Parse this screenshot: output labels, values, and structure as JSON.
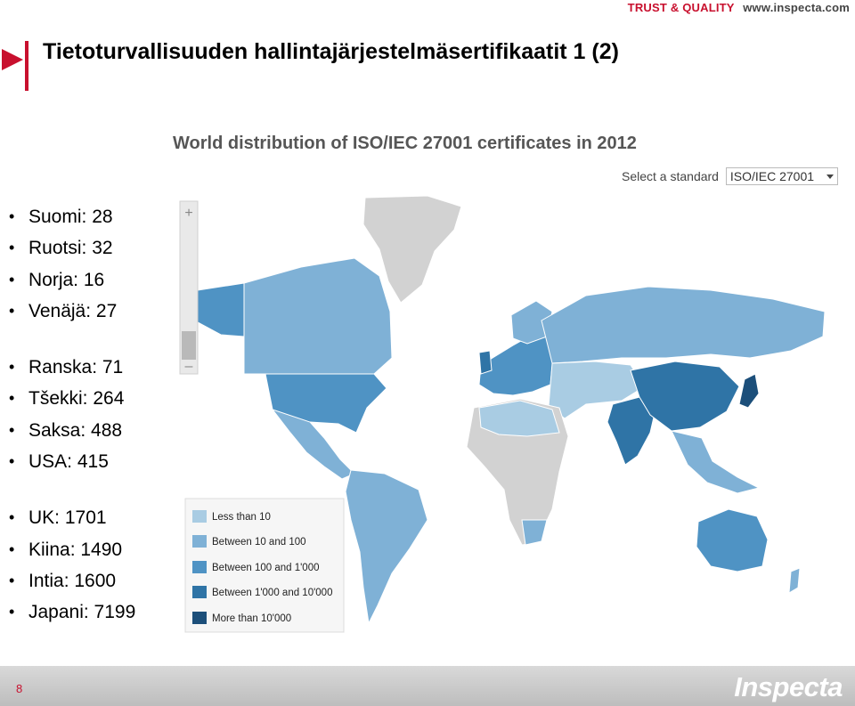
{
  "header": {
    "brand_tagline": "TRUST & QUALITY",
    "brand_url": "www.inspecta.com",
    "title": "Tietoturvallisuuden hallintajärjestelmäsertifikaatit 1 (2)"
  },
  "bullets": {
    "groups": [
      {
        "items": [
          "Suomi: 28",
          "Ruotsi: 32",
          "Norja: 16",
          "Venäjä: 27"
        ]
      },
      {
        "items": [
          "Ranska: 71",
          "Tšekki: 264",
          "Saksa: 488",
          "USA: 415"
        ]
      },
      {
        "items": [
          "UK: 1701",
          "Kiina: 1490",
          "Intia: 1600",
          "Japani: 7199"
        ]
      }
    ]
  },
  "map": {
    "title": "World distribution of ISO/IEC 27001 certificates in 2012",
    "select_label": "Select a standard",
    "select_value": "ISO/IEC 27001",
    "zoom_in_symbol": "+",
    "zoom_out_symbol": "–",
    "legend": [
      {
        "label": "Less than 10",
        "color": "#a9cce3"
      },
      {
        "label": "Between 10 and 100",
        "color": "#7fb1d6"
      },
      {
        "label": "Between 100 and 1'000",
        "color": "#4f93c4"
      },
      {
        "label": "Between 1'000 and 10'000",
        "color": "#2f74a6"
      },
      {
        "label": "More than 10'000",
        "color": "#1c4f7a"
      }
    ],
    "no_data_color": "#d2d2d2",
    "ocean_color": "#ffffff"
  },
  "footer": {
    "page_number": "8",
    "logo_text": "Inspecta"
  }
}
